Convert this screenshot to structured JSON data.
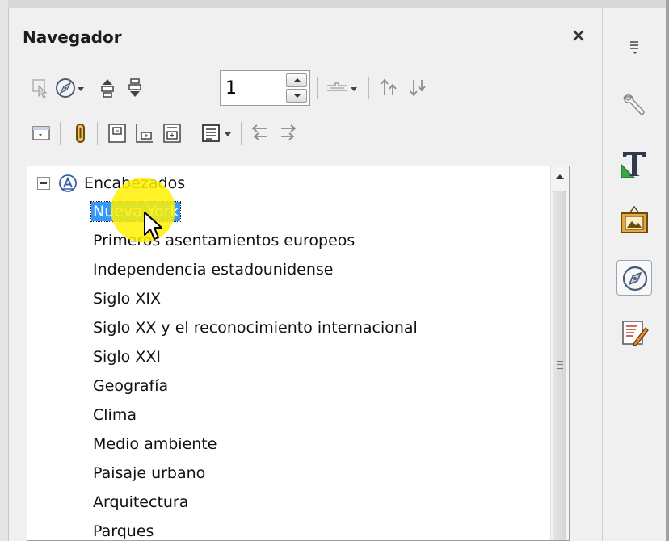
{
  "panel": {
    "title": "Navegador",
    "close_symbol": "×"
  },
  "toolbar": {
    "page_number": "1",
    "row1_icons": [
      "toggle-icon",
      "navigation-compass-icon",
      "dropdown-arrow-icon",
      "previous-icon",
      "next-icon",
      "page-spin",
      "drag-mode-icon",
      "dropdown-arrow-icon",
      "promote-level-icon",
      "demote-level-icon"
    ],
    "row2_icons": [
      "content-view-icon",
      "reminder-icon",
      "header-icon",
      "footer-icon",
      "anchor-icon",
      "list-box-icon",
      "dropdown-arrow-icon",
      "promote-chapter-icon",
      "demote-chapter-icon"
    ]
  },
  "tree": {
    "root_label": "Encabezados",
    "root_icon": "headings-category-icon",
    "items": [
      {
        "label": "Nueva York",
        "selected": true
      },
      {
        "label": "Primeros asentamientos europeos",
        "selected": false
      },
      {
        "label": "Independencia estadounidense",
        "selected": false
      },
      {
        "label": "Siglo XIX",
        "selected": false
      },
      {
        "label": "Siglo XX y el reconocimiento internacional",
        "selected": false
      },
      {
        "label": "Siglo XXI",
        "selected": false
      },
      {
        "label": "Geografía",
        "selected": false
      },
      {
        "label": "Clima",
        "selected": false
      },
      {
        "label": "Medio ambiente",
        "selected": false
      },
      {
        "label": "Paisaje urbano",
        "selected": false
      },
      {
        "label": "Arquitectura",
        "selected": false
      },
      {
        "label": "Parques",
        "selected": false
      }
    ]
  },
  "sidebar": {
    "icons": [
      "sidebar-menu-icon",
      "properties-wrench-icon",
      "styles-formatting-icon",
      "gallery-icon",
      "navigator-compass-icon",
      "manage-changes-icon"
    ],
    "active": "navigator-compass-icon"
  },
  "colors": {
    "selection": "#3399ff",
    "cursor_highlight": "#fff000",
    "panel_bg": "#f0f0f0"
  }
}
